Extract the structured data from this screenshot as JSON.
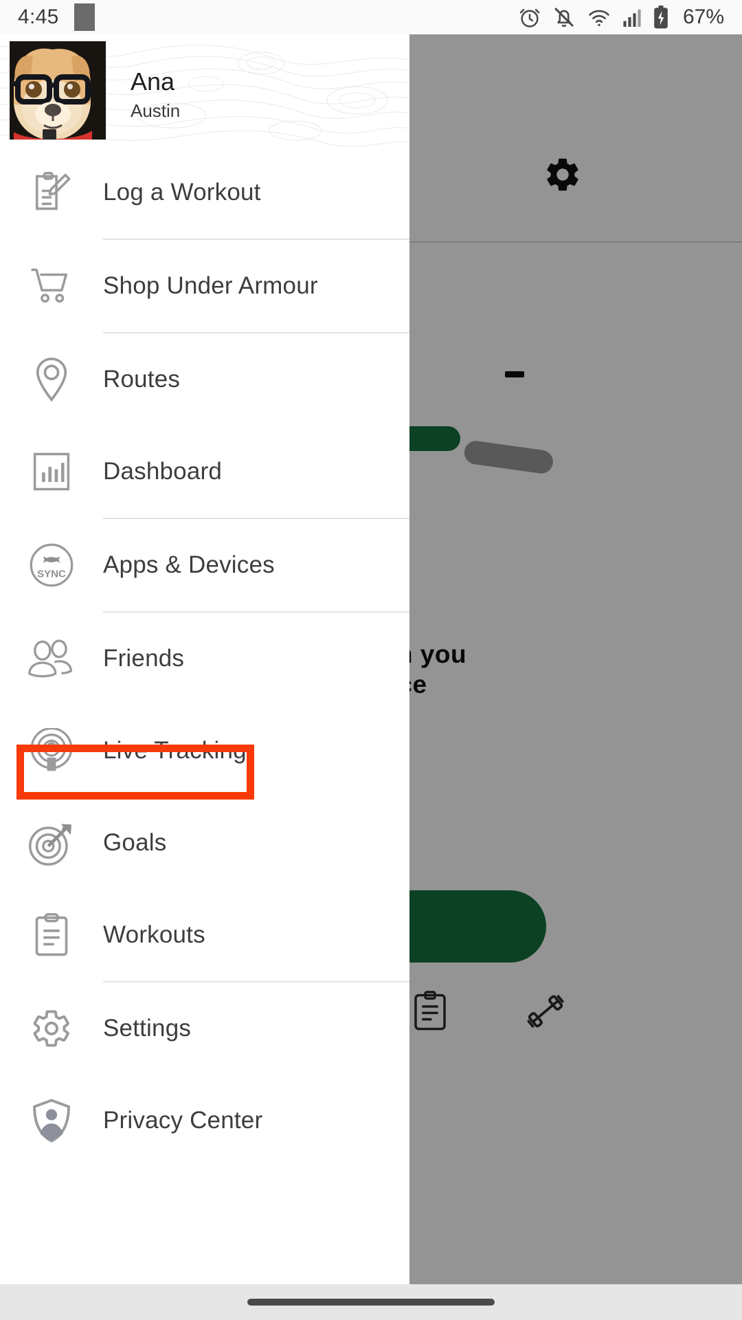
{
  "status_bar": {
    "time": "4:45",
    "battery_percent": "67%",
    "icons": [
      "alarm-icon",
      "notifications-off-icon",
      "wifi-icon",
      "cellular-signal-icon",
      "battery-charging-icon"
    ]
  },
  "drawer": {
    "profile": {
      "name": "Ana",
      "location": "Austin",
      "avatar_alt": "dog-profile-photo"
    },
    "items": [
      {
        "label": "Log a Workout",
        "icon": "log-workout-icon",
        "divider_after": true,
        "highlighted": false
      },
      {
        "label": "Shop Under Armour",
        "icon": "shopping-cart-icon",
        "divider_after": true,
        "highlighted": false
      },
      {
        "label": "Routes",
        "icon": "map-pin-icon",
        "divider_after": false,
        "highlighted": false
      },
      {
        "label": "Dashboard",
        "icon": "bar-chart-icon",
        "divider_after": true,
        "highlighted": false
      },
      {
        "label": "Apps & Devices",
        "icon": "ua-sync-icon",
        "divider_after": true,
        "highlighted": false
      },
      {
        "label": "Friends",
        "icon": "friends-icon",
        "divider_after": false,
        "highlighted": false
      },
      {
        "label": "Live Tracking",
        "icon": "live-tracking-icon",
        "divider_after": false,
        "highlighted": false
      },
      {
        "label": "Goals",
        "icon": "target-arrow-icon",
        "divider_after": false,
        "highlighted": true
      },
      {
        "label": "Workouts",
        "icon": "clipboard-icon",
        "divider_after": true,
        "highlighted": false
      },
      {
        "label": "Settings",
        "icon": "gear-icon",
        "divider_after": false,
        "highlighted": false
      },
      {
        "label": "Privacy Center",
        "icon": "shield-person-icon",
        "divider_after": false,
        "highlighted": false
      }
    ]
  },
  "background_app": {
    "headline_line_1": "l coach you",
    "headline_line_2": "cadence",
    "settings_icon": "gear-icon",
    "tab_icons": [
      "clipboard-tab-icon",
      "dumbbell-tab-icon"
    ]
  },
  "nav_bar": {
    "home_indicator": "home-indicator-pill"
  },
  "colors": {
    "highlight": "#f93a0a",
    "brand_green": "#16713e",
    "divider": "#e3e3e3",
    "text_primary": "#3d3d3d",
    "scrim": "rgba(0,0,0,0.42)"
  }
}
